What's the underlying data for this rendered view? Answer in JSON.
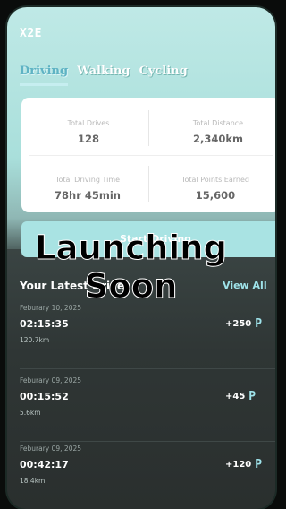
{
  "app": {
    "logo": "X2E"
  },
  "tabs": [
    {
      "label": "Driving",
      "active": true
    },
    {
      "label": "Walking",
      "active": false
    },
    {
      "label": "Cycling",
      "active": false
    }
  ],
  "stats": {
    "total_drives": {
      "label": "Total Drives",
      "value": "128"
    },
    "total_distance": {
      "label": "Total Distance",
      "value": "2,340km"
    },
    "total_time": {
      "label": "Total Driving Time",
      "value": "78hr 45min"
    },
    "total_points": {
      "label": "Total Points Earned",
      "value": "15,600"
    }
  },
  "start_button": "Start Driving",
  "overlay": {
    "line1": "Launching",
    "line2": "Soon"
  },
  "latest": {
    "title": "Your Latest Drives",
    "view_all": "View All",
    "drives": [
      {
        "date": "Feburary 10, 2025",
        "time": "02:15:35",
        "distance": "120.7km",
        "points": "+250"
      },
      {
        "date": "Feburary 09, 2025",
        "time": "00:15:52",
        "distance": "5.6km",
        "points": "+45"
      },
      {
        "date": "Feburary 09, 2025",
        "time": "00:42:17",
        "distance": "18.4km",
        "points": "+120"
      }
    ]
  },
  "colors": {
    "accent": "#5fb3c4",
    "header_bg": "#bfe9e6",
    "list_bg": "#2f3635",
    "overlay_text": "#000000"
  },
  "icons": {
    "points": "P-coin-icon"
  }
}
